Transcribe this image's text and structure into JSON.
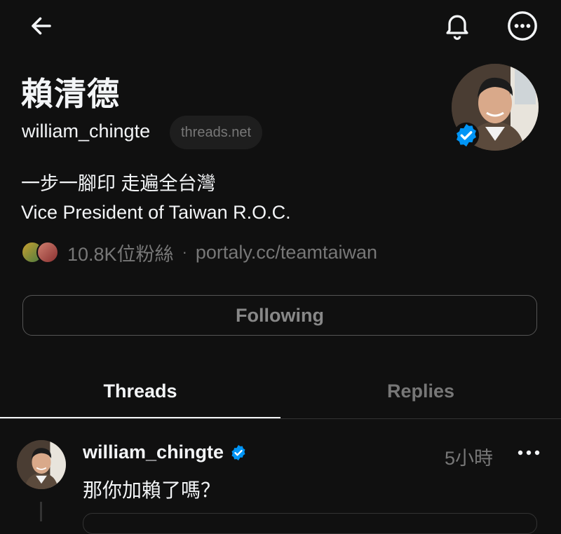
{
  "nav": {
    "back_icon": "arrow-left-icon",
    "bell_icon": "bell-icon",
    "more_icon": "more-circle-icon"
  },
  "profile": {
    "display_name": "賴清德",
    "username": "william_chingte",
    "domain_chip": "threads.net",
    "verified": true,
    "bio_line1": "一步一腳印 走遍全台灣",
    "bio_line2": "Vice President of Taiwan R.O.C.",
    "followers": "10.8K位粉絲",
    "separator": "·",
    "link": "portaly.cc/teamtaiwan"
  },
  "actions": {
    "following_label": "Following"
  },
  "tabs": [
    {
      "label": "Threads",
      "active": true
    },
    {
      "label": "Replies",
      "active": false
    }
  ],
  "post": {
    "username": "william_chingte",
    "verified": true,
    "time": "5小時",
    "text": "那你加賴了嗎？",
    "more_icon": "ellipsis-icon"
  },
  "colors": {
    "background": "#101010",
    "text": "#f3f5f7",
    "muted": "#777777",
    "verified_blue": "#0095f6"
  }
}
